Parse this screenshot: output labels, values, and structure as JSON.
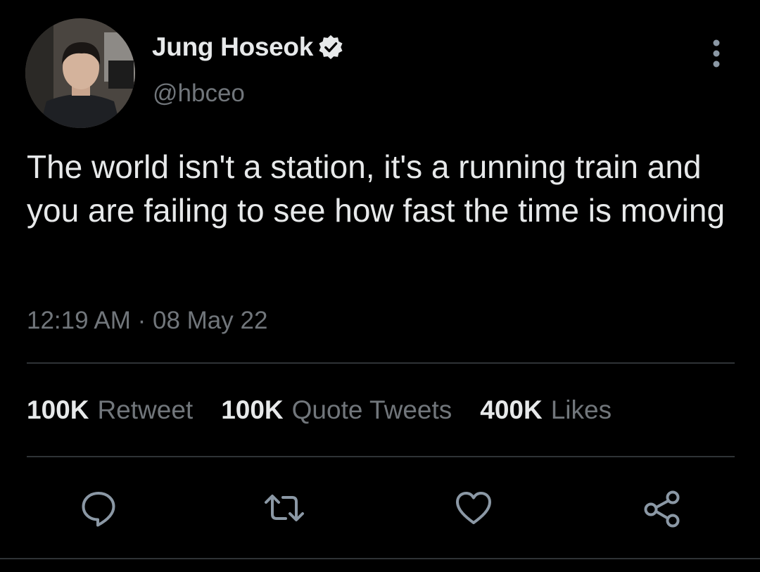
{
  "author": {
    "display_name": "Jung Hoseok",
    "handle": "@hbceo",
    "verified": true
  },
  "tweet": {
    "text": "The world isn't a station, it's a running train and you are failing to see how fast the time is moving",
    "timestamp": "12:19 AM · 08 May 22"
  },
  "stats": [
    {
      "count": "100K",
      "label": "Retweet"
    },
    {
      "count": "100K",
      "label": "Quote Tweets"
    },
    {
      "count": "400K",
      "label": "Likes"
    }
  ],
  "actions": {
    "reply_icon": "reply-icon",
    "retweet_icon": "retweet-icon",
    "like_icon": "heart-icon",
    "share_icon": "share-icon"
  },
  "colors": {
    "background": "#000000",
    "primary_text": "#e7e9ea",
    "secondary_text": "#71767b",
    "divider": "#2f3336",
    "icon": "#8b98a5"
  }
}
